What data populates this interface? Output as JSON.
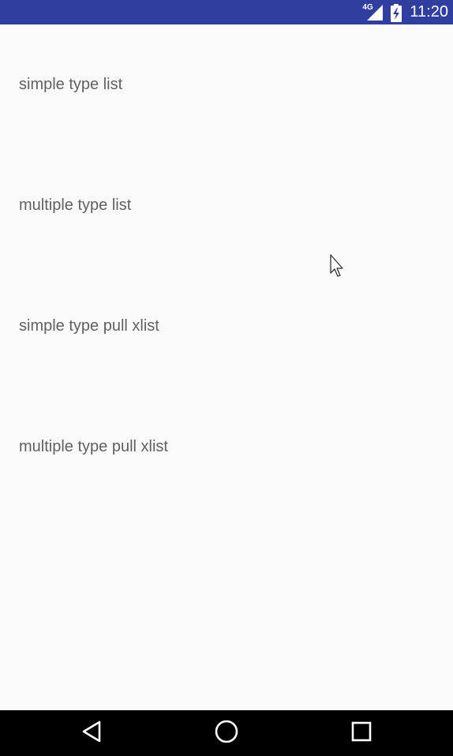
{
  "status_bar": {
    "network_type": "4G",
    "time": "11:20",
    "background_color": "#303f9f",
    "signal_icon": "cellular-signal-icon",
    "battery_icon": "battery-charging-icon"
  },
  "list": {
    "items": [
      {
        "label": "simple type list"
      },
      {
        "label": "multiple type list"
      },
      {
        "label": "simple type pull xlist"
      },
      {
        "label": "multiple type pull xlist"
      }
    ],
    "text_color": "#616161",
    "background_color": "#fafafa"
  },
  "nav_bar": {
    "back_icon": "back-triangle-icon",
    "home_icon": "home-circle-icon",
    "recents_icon": "recents-square-icon",
    "background_color": "#000000"
  },
  "pointer": {
    "icon": "mouse-cursor-icon"
  }
}
